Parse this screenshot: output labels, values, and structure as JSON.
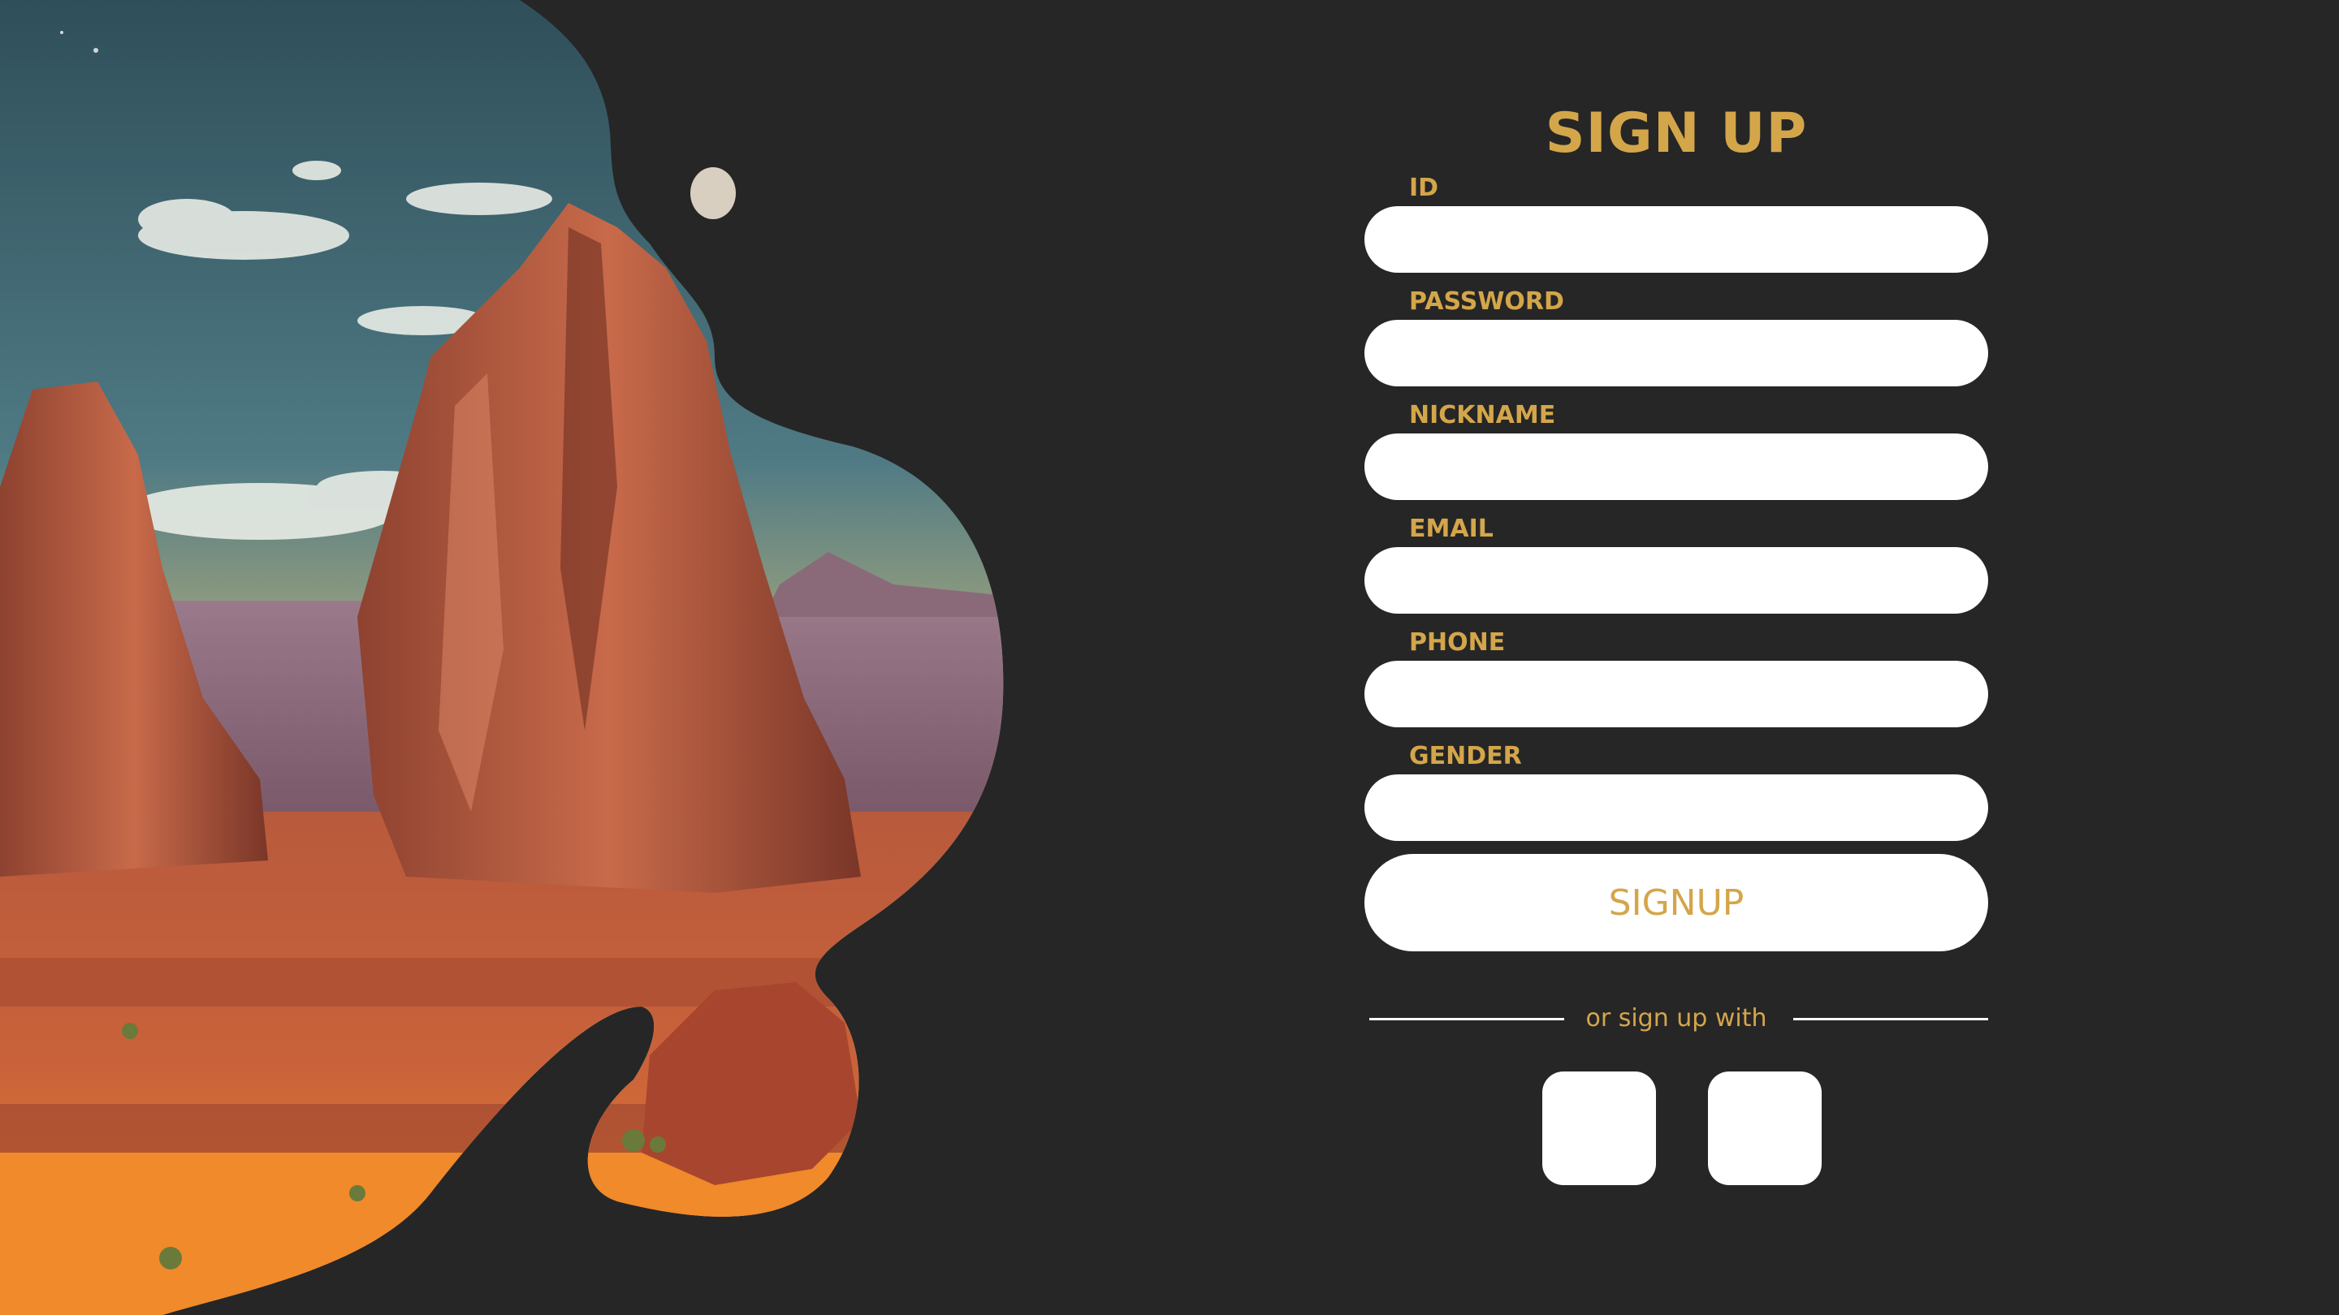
{
  "colors": {
    "background": "#262626",
    "accent": "#d4a64a",
    "input_background": "#ffffff"
  },
  "hero": {
    "description_icon": "desert-landscape-illustration"
  },
  "form": {
    "title": "SIGN UP",
    "fields": [
      {
        "label": "ID",
        "value": "",
        "placeholder": ""
      },
      {
        "label": "PASSWORD",
        "value": "",
        "placeholder": ""
      },
      {
        "label": "NICKNAME",
        "value": "",
        "placeholder": ""
      },
      {
        "label": "EMAIL",
        "value": "",
        "placeholder": ""
      },
      {
        "label": "PHONE",
        "value": "",
        "placeholder": ""
      },
      {
        "label": "GENDER",
        "value": "",
        "placeholder": ""
      }
    ],
    "submit_label": "SIGNUP",
    "divider_text": "or sign up with",
    "social_buttons": [
      {
        "icon": "social-login-icon"
      },
      {
        "icon": "social-login-icon"
      }
    ]
  }
}
